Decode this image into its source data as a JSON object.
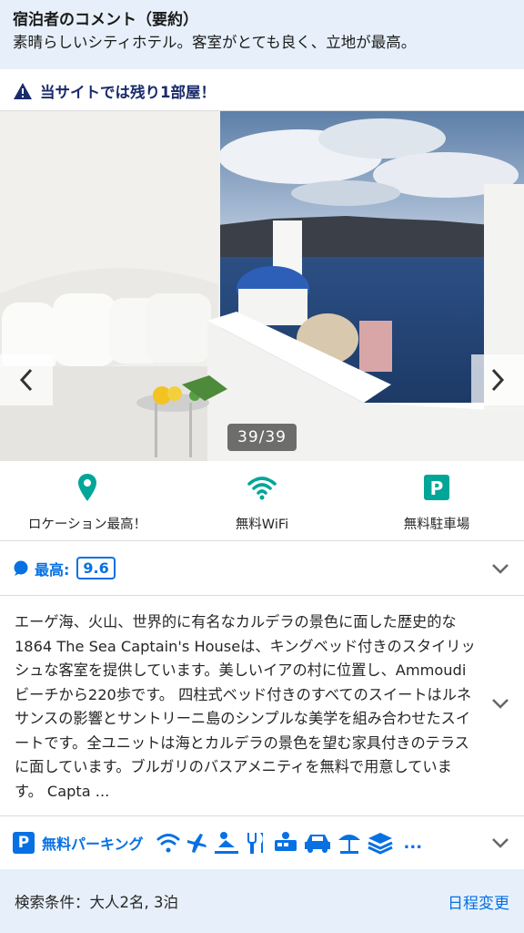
{
  "review": {
    "title": "宿泊者のコメント（要約）",
    "text": "素晴らしいシティホテル。客室がとても良く、立地が最高。"
  },
  "alert": {
    "icon": "warning-icon",
    "text": "当サイトでは残り1部屋！"
  },
  "gallery": {
    "counter": "39/39",
    "prev_icon": "chevron-left-icon",
    "next_icon": "chevron-right-icon"
  },
  "features": [
    {
      "icon": "location-pin-icon",
      "label": "ロケーション最高！",
      "color": "#00a698"
    },
    {
      "icon": "wifi-icon",
      "label": "無料WiFi",
      "color": "#00a698"
    },
    {
      "icon": "parking-icon",
      "label": "無料駐車場",
      "color": "#00a698"
    }
  ],
  "rating": {
    "label": "最高:",
    "score": "9.6",
    "color": "#0770e3"
  },
  "description": {
    "text": "エーゲ海、火山、世界的に有名なカルデラの景色に面した歴史的な1864 The Sea Captain's Houseは、キングベッド付きのスタイリッシュな客室を提供しています。美しいイアの村に位置し、Ammoudiビーチから220歩です。 四柱式ベッド付きのすべてのスイートはルネサンスの影響とサントリーニ島のシンプルな美学を組み合わせたスイートです。全ユニットは海とカルデラの景色を望む家具付きのテラスに面しています。ブルガリのバスアメニティを無料で用意しています。 Capta ..."
  },
  "amenities": {
    "label": "無料パーキング",
    "icons": [
      "wifi-icon",
      "airplane-icon",
      "spa-icon",
      "restaurant-icon",
      "shuttle-icon",
      "car-icon",
      "beach-icon",
      "towels-icon"
    ],
    "more": "..."
  },
  "search": {
    "conditions": "検索条件：大人2名, 3泊",
    "change_label": "日程変更"
  },
  "colors": {
    "accent": "#0770e3",
    "green": "#00a698",
    "light_blue_bg": "#e7f0fa"
  }
}
